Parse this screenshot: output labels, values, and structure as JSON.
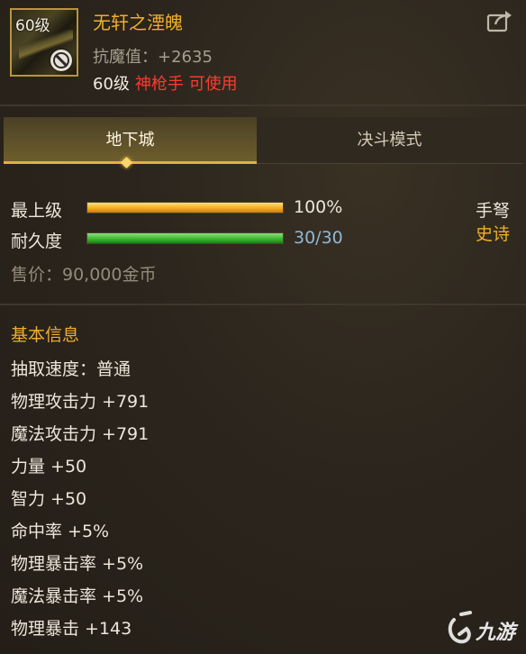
{
  "item": {
    "icon_badge": "60级",
    "name": "无轩之湮魄",
    "stat": "抗魔值：+2635",
    "req_level": "60级",
    "req_class": "神枪手 可使用"
  },
  "tabs": [
    {
      "label": "地下城",
      "active": true
    },
    {
      "label": "决斗模式",
      "active": false
    }
  ],
  "bars": {
    "upgrade": {
      "label": "最上级",
      "value_text": "100%",
      "fraction": 1.0
    },
    "durability": {
      "label": "耐久度",
      "value_text": "30/30",
      "fraction": 1.0
    }
  },
  "type": {
    "weapon": "手弩",
    "rarity": "史诗"
  },
  "sell_price": "售价：90,000金币",
  "basic_info": {
    "title": "基本信息",
    "lines": [
      "抽取速度：普通",
      "物理攻击力 +791",
      "魔法攻击力 +791",
      "力量 +50",
      "智力 +50",
      "命中率 +5%",
      "物理暴击率 +5%",
      "魔法暴击率 +5%",
      "物理暴击 +143"
    ]
  },
  "watermark": "九游",
  "colors": {
    "accent_gold": "#f1ae2c",
    "required_red": "#ff3a30",
    "durability_text": "#8fb8d8",
    "rarity_epic": "#f1ae2c"
  },
  "icons": [
    "item-no-entry-icon",
    "share-icon",
    "tab-selected-diamond-icon",
    "jiuyou-logo-icon"
  ]
}
